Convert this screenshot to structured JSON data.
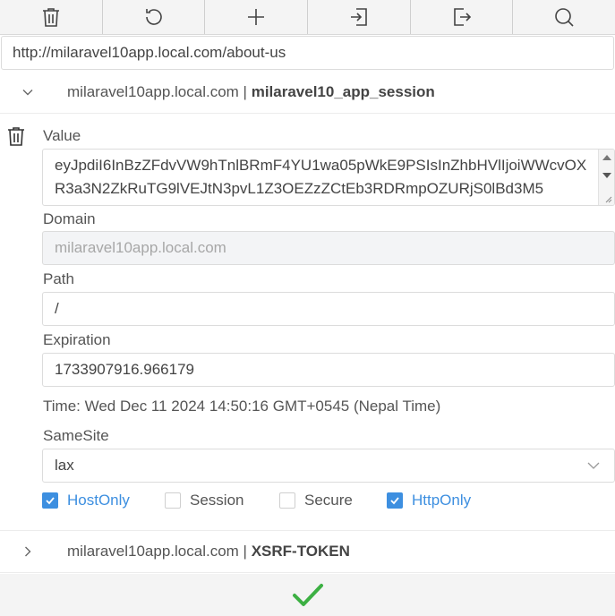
{
  "toolbar": {
    "buttons": [
      {
        "icon": "trash-icon",
        "name": "delete-all-button"
      },
      {
        "icon": "refresh-icon",
        "name": "refresh-button"
      },
      {
        "icon": "plus-icon",
        "name": "add-cookie-button"
      },
      {
        "icon": "import-icon",
        "name": "import-button"
      },
      {
        "icon": "export-icon",
        "name": "export-button"
      },
      {
        "icon": "search-icon",
        "name": "search-button"
      }
    ]
  },
  "url": "http://milaravel10app.local.com/about-us",
  "cookies": [
    {
      "domain": "milaravel10app.local.com",
      "separator": " | ",
      "name": "milaravel10_app_session",
      "expanded": true
    },
    {
      "domain": "milaravel10app.local.com",
      "separator": " | ",
      "name": "XSRF-TOKEN",
      "expanded": false
    }
  ],
  "detail": {
    "value_label": "Value",
    "value": "eyJpdiI6InBzZFdvVW9hTnlBRmF4YU1wa05pWkE9PSIsInZhbHVlIjoiWWcvOXR3a3N2ZkRuTG9lVEJtN3pvL1Z3OEZzZCtEb3RDRmpOZURjS0lBd3M5",
    "domain_label": "Domain",
    "domain_value": "milaravel10app.local.com",
    "path_label": "Path",
    "path_value": "/",
    "expiration_label": "Expiration",
    "expiration_value": "1733907916.966179",
    "time_text": "Time: Wed Dec 11 2024 14:50:16 GMT+0545 (Nepal Time)",
    "samesite_label": "SameSite",
    "samesite_value": "lax",
    "flags": [
      {
        "label": "HostOnly",
        "checked": true
      },
      {
        "label": "Session",
        "checked": false
      },
      {
        "label": "Secure",
        "checked": false
      },
      {
        "label": "HttpOnly",
        "checked": true
      }
    ]
  },
  "colors": {
    "accent": "#3d8fe0",
    "save": "#3cb043"
  },
  "footer": {
    "icon": "check-icon"
  }
}
